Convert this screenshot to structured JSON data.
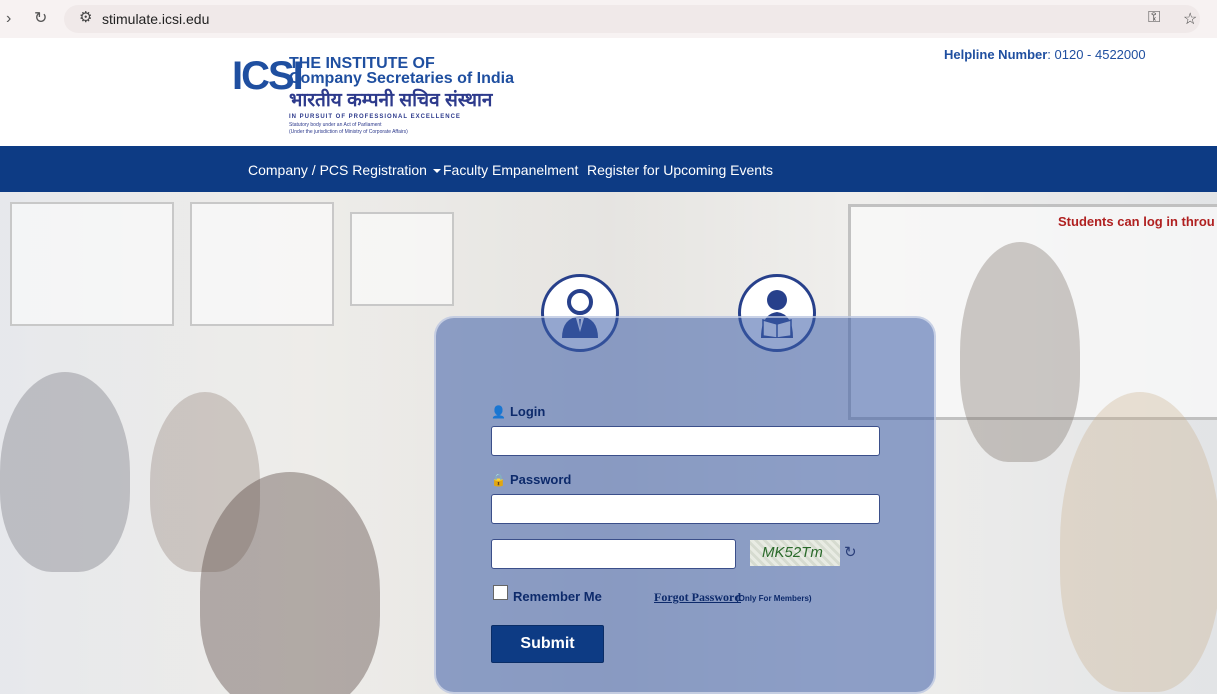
{
  "browser": {
    "url": "stimulate.icsi.edu",
    "back_icon": "chevron-right",
    "reload_icon": "reload",
    "site_info_icon": "tune",
    "key_icon": "key",
    "star_icon": "star"
  },
  "header": {
    "logo_mark": "ICSI",
    "line1": "THE INSTITUTE OF",
    "line2": "Company Secretaries of India",
    "hindi": "भारतीय कम्पनी सचिव संस्थान",
    "tagline": "IN PURSUIT OF PROFESSIONAL EXCELLENCE",
    "sub1": "Statutory body under an Act of Parliament",
    "sub2": "(Under the jurisdiction of Ministry of Corporate Affairs)",
    "helpline_label": "Helpline Number",
    "helpline_value": ": 0120 - 4522000"
  },
  "nav": {
    "items": [
      {
        "label": "Company / PCS Registration"
      },
      {
        "label": "Faculty Empanelment"
      },
      {
        "label": "Register for Upcoming Events"
      }
    ]
  },
  "marquee": "Students can log in throu",
  "login": {
    "login_label": "Login",
    "password_label": "Password",
    "login_value": "",
    "password_value": "",
    "captcha_input_value": "",
    "captcha_text": "MK52Tm",
    "remember_label": "Remember Me",
    "forgot_label": "Forgot Password",
    "forgot_note": "(Only For Members)",
    "submit_label": "Submit"
  },
  "colors": {
    "nav_bg": "#0d3b84",
    "brand_blue": "#1f4fa0",
    "marquee_red": "#b02020"
  }
}
